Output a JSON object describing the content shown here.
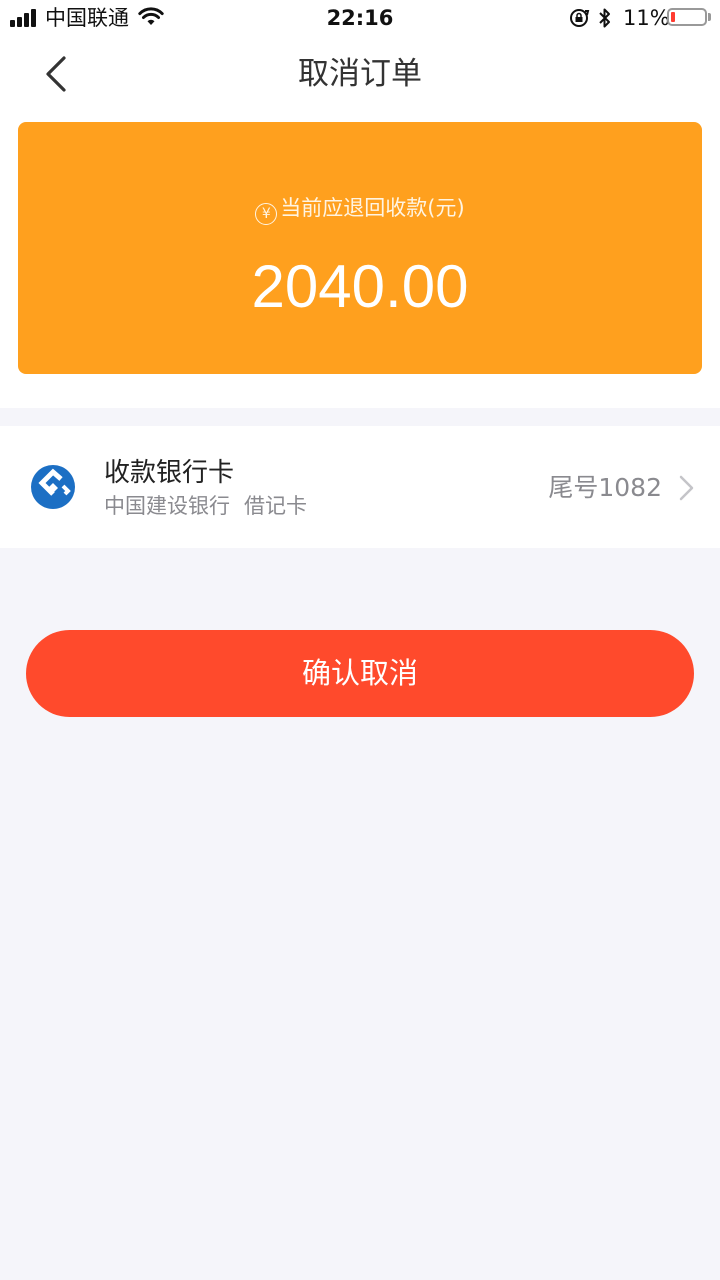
{
  "status_bar": {
    "carrier": "中国联通",
    "time": "22:16",
    "battery_percent": "11%",
    "battery_level": 0.11,
    "icons": [
      "signal-icon",
      "wifi-icon",
      "rotation-lock-icon",
      "bluetooth-icon",
      "battery-icon"
    ]
  },
  "nav": {
    "title": "取消订单",
    "back_icon": "back-chevron-icon"
  },
  "refund": {
    "icon": "yen-icon",
    "icon_glyph": "¥",
    "label": "当前应退回收款(元)",
    "amount": "2040.00",
    "background_color": "#ffa01e"
  },
  "bank": {
    "title": "收款银行卡",
    "bank_name": "中国建设银行",
    "card_type": "借记卡",
    "card_tail": "尾号1082",
    "logo_icon": "ccb-bank-logo-icon",
    "logo_color": "#1c6fc4"
  },
  "confirm": {
    "label": "确认取消",
    "color": "#ff4a2c"
  }
}
